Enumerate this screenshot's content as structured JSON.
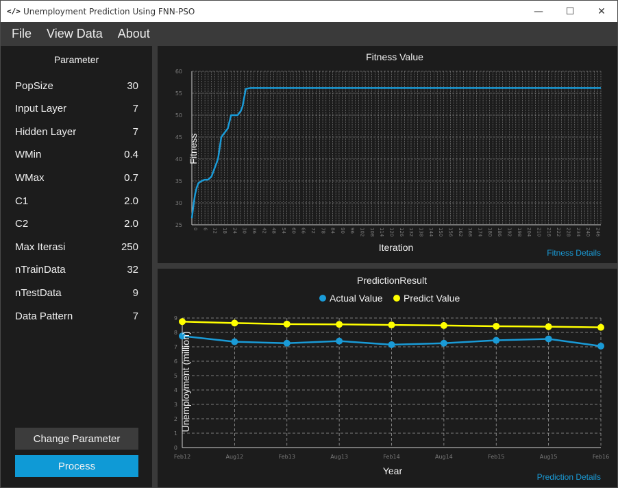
{
  "window": {
    "app_icon": "</>",
    "title": "Unemployment Prediction Using FNN-PSO",
    "controls": {
      "minimize": "—",
      "maximize": "☐",
      "close": "✕"
    }
  },
  "menu": {
    "file": "File",
    "view_data": "View Data",
    "about": "About"
  },
  "sidebar": {
    "title": "Parameter",
    "params": [
      {
        "label": "PopSize",
        "value": "30"
      },
      {
        "label": "Input Layer",
        "value": "7"
      },
      {
        "label": "Hidden Layer",
        "value": "7"
      },
      {
        "label": "WMin",
        "value": "0.4"
      },
      {
        "label": "WMax",
        "value": "0.7"
      },
      {
        "label": "C1",
        "value": "2.0"
      },
      {
        "label": "C2",
        "value": "2.0"
      },
      {
        "label": "Max Iterasi",
        "value": "250"
      },
      {
        "label": "nTrainData",
        "value": "32"
      },
      {
        "label": "nTestData",
        "value": "9"
      },
      {
        "label": "Data Pattern",
        "value": "7"
      }
    ],
    "change_button": "Change Parameter",
    "process_button": "Process"
  },
  "colors": {
    "accent": "#0f9ad6",
    "actual": "#1a9bd7",
    "predict": "#ffff00",
    "fitness_line": "#1a9bd7"
  },
  "links": {
    "fitness_details": "Fitness Details",
    "prediction_details": "Prediction Details"
  },
  "chart_data": [
    {
      "type": "line",
      "title": "Fitness Value",
      "xlabel": "Iteration",
      "ylabel": "Fitness",
      "ylim": [
        25,
        60
      ],
      "yticks": [
        25,
        30,
        35,
        40,
        45,
        50,
        55,
        60
      ],
      "xlim": [
        0,
        250
      ],
      "grid": true,
      "series": [
        {
          "x": [
            0,
            1,
            2,
            3,
            4,
            6,
            8,
            10,
            12,
            14,
            16,
            18,
            20,
            22,
            24,
            26,
            28,
            30,
            31,
            33,
            36,
            38,
            250
          ],
          "values": [
            26.5,
            29.5,
            32,
            33.5,
            34.5,
            35,
            35.3,
            35.3,
            36,
            38,
            40,
            45,
            46,
            47,
            50,
            50,
            50,
            51,
            52,
            56,
            56.2,
            56.2,
            56.2
          ]
        }
      ]
    },
    {
      "type": "line",
      "title": "PredictionResult",
      "xlabel": "Year",
      "ylabel": "Unemployment (million)",
      "ylim": [
        0,
        9
      ],
      "yticks": [
        0,
        1,
        2,
        3,
        4,
        5,
        6,
        7,
        8,
        9
      ],
      "categories": [
        "Feb12",
        "Aug12",
        "Feb13",
        "Aug13",
        "Feb14",
        "Aug14",
        "Feb15",
        "Aug15",
        "Feb16"
      ],
      "legend": "top",
      "grid": true,
      "series": [
        {
          "name": "Actual Value",
          "values": [
            7.75,
            7.35,
            7.25,
            7.4,
            7.15,
            7.25,
            7.45,
            7.55,
            7.05
          ]
        },
        {
          "name": "Predict Value",
          "values": [
            8.75,
            8.65,
            8.58,
            8.56,
            8.52,
            8.48,
            8.43,
            8.4,
            8.35
          ]
        }
      ]
    }
  ]
}
